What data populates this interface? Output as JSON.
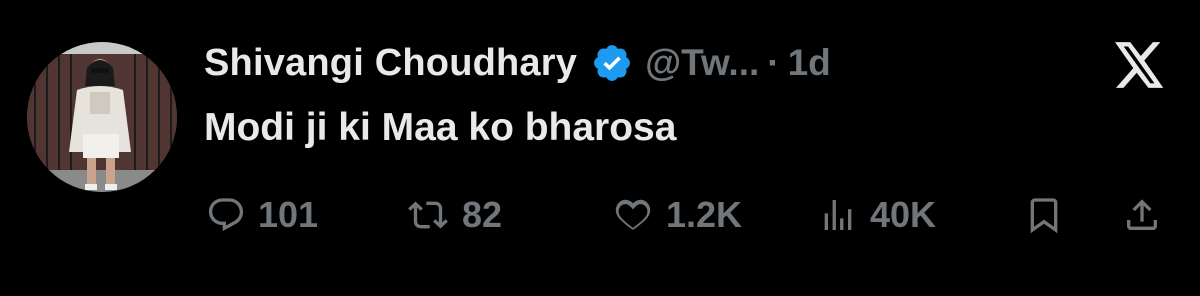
{
  "author": {
    "name": "Shivangi Choudhary",
    "handle": "@Tw...",
    "separator": "·",
    "timestamp": "1d",
    "verified": true
  },
  "tweet": {
    "text": "Modi ji ki Maa ko bharosa"
  },
  "stats": {
    "replies": "101",
    "retweets": "82",
    "likes": "1.2K",
    "views": "40K"
  },
  "colors": {
    "background": "#000000",
    "text_primary": "#e7e9ea",
    "text_secondary": "#71767b",
    "verified_blue": "#1d9bf0"
  },
  "icons": [
    "x-logo-icon",
    "verified-badge-icon",
    "reply-icon",
    "retweet-icon",
    "like-icon",
    "views-icon",
    "bookmark-icon",
    "share-icon"
  ]
}
